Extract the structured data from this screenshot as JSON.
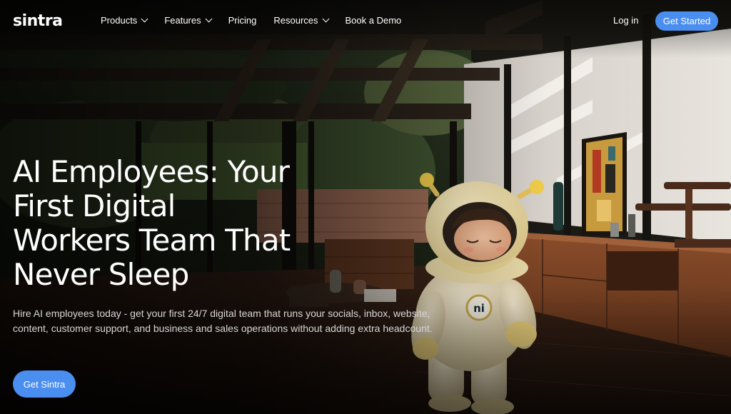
{
  "brand": {
    "logo_text": "sintra",
    "accent_color": "#4a8ef0"
  },
  "nav": {
    "items": [
      {
        "label": "Products",
        "has_dropdown": true
      },
      {
        "label": "Features",
        "has_dropdown": true
      },
      {
        "label": "Pricing",
        "has_dropdown": false
      },
      {
        "label": "Resources",
        "has_dropdown": true
      },
      {
        "label": "Book a Demo",
        "has_dropdown": false
      }
    ],
    "login_label": "Log in",
    "cta_label": "Get Started"
  },
  "hero": {
    "headline_lines": [
      "AI Employees: Your",
      "First Digital",
      "Workers Team That",
      "Never Sleep"
    ],
    "subtext": "Hire AI employees today - get your first 24/7 digital team that runs your socials, inbox, website, content, customer support, and business and sales operations without adding extra headcount.",
    "cta_label": "Get Sintra",
    "mascot_badge_text": "ni"
  }
}
